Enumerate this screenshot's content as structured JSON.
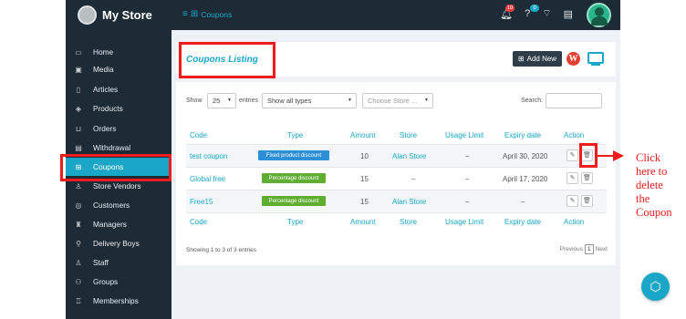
{
  "topbar": {
    "brand": "My Store",
    "breadcrumb": "Coupons",
    "notification_count": "10",
    "help_count": "0"
  },
  "sidebar": {
    "items": [
      {
        "label": "Home",
        "icon": "monitor-icon"
      },
      {
        "label": "Media",
        "icon": "image-icon"
      },
      {
        "label": "Articles",
        "icon": "file-icon"
      },
      {
        "label": "Products",
        "icon": "cube-icon"
      },
      {
        "label": "Orders",
        "icon": "cart-icon"
      },
      {
        "label": "Withdrawal",
        "icon": "money-icon"
      },
      {
        "label": "Coupons",
        "icon": "gift-icon"
      },
      {
        "label": "Store Vendors",
        "icon": "user-icon"
      },
      {
        "label": "Customers",
        "icon": "customer-icon"
      },
      {
        "label": "Managers",
        "icon": "manager-icon"
      },
      {
        "label": "Delivery Boys",
        "icon": "bike-icon"
      },
      {
        "label": "Staff",
        "icon": "staff-icon"
      },
      {
        "label": "Groups",
        "icon": "groups-icon"
      },
      {
        "label": "Memberships",
        "icon": "membership-icon"
      }
    ]
  },
  "header": {
    "title": "Coupons Listing",
    "add_new": "Add New"
  },
  "controls": {
    "show_label": "Show",
    "page_length": "25",
    "entries_label": "entries",
    "type_filter": "Show all types",
    "store_filter": "Choose Store ...",
    "search_label": "Search:"
  },
  "table": {
    "columns": [
      "Code",
      "Type",
      "Amount",
      "Store",
      "Usage Limit",
      "Expiry date",
      "Action"
    ],
    "rows": [
      {
        "code": "test coupon",
        "type": "Fixed product discount",
        "amount": "10",
        "store": "Alan Store",
        "usage": "–",
        "expiry": "April 30, 2020"
      },
      {
        "code": "Global free",
        "type": "Percentage discount",
        "amount": "15",
        "store": "–",
        "usage": "–",
        "expiry": "April 17, 2020"
      },
      {
        "code": "Free15",
        "type": "Percentage discount",
        "amount": "15",
        "store": "Alan Store",
        "usage": "–",
        "expiry": "–"
      }
    ],
    "showing": "Showing 1 to 3 of 3 entries",
    "previous": "Previous",
    "page": "1",
    "next": "Next"
  },
  "annotation": {
    "line1": "Click",
    "line2": "here to",
    "line3": "delete",
    "line4": "the",
    "line5": "Coupon"
  },
  "colors": {
    "accent": "#1aa7c7",
    "sidebar": "#1c2b36",
    "annotation_red": "#ee1c1c",
    "tag_blue": "#2d8fd5",
    "tag_green": "#5fae32"
  }
}
